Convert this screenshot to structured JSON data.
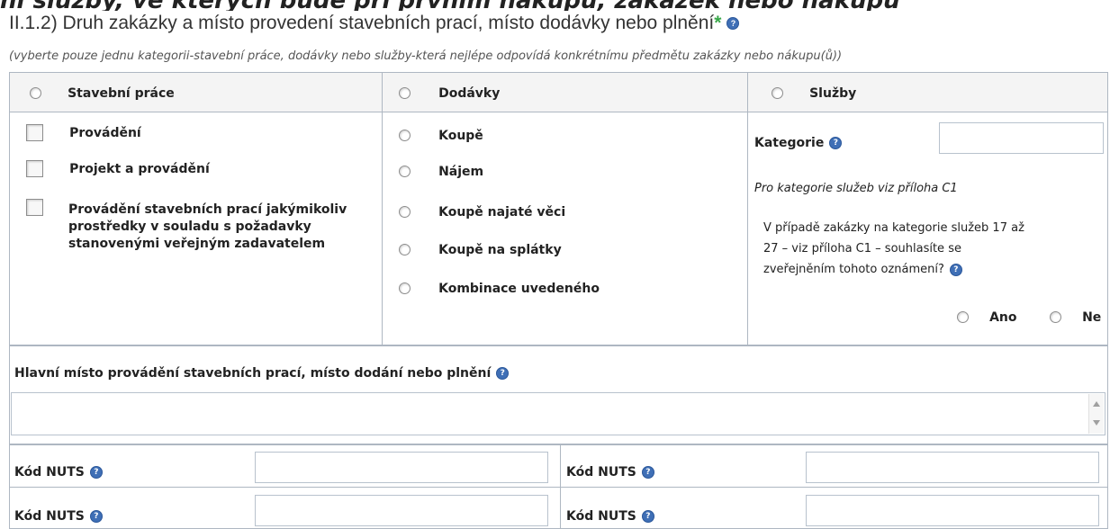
{
  "section": {
    "top_cut_text": "ní služby, ve kterých bude při prvním nákupu, zakázek nebo nákupu",
    "title": "II.1.2) Druh zakázky a místo provedení stavebních prací, místo dodávky nebo plnění",
    "required_mark": "*",
    "help_glyph": "?",
    "subtitle": "(vyberte pouze jednu kategorii-stavební práce, dodávky nebo služby-která nejlépe odpovídá konkrétnímu předmětu zakázky nebo nákupu(ů))"
  },
  "categories": {
    "construction": "Stavební práce",
    "supplies": "Dodávky",
    "services": "Služby"
  },
  "construction_options": [
    "Provádění",
    "Projekt a provádění",
    "Provádění stavebních prací jakýmikoliv",
    "prostředky v souladu s požadavky",
    "stanovenými veřejným zadavatelem"
  ],
  "supplies_options": [
    "Koupě",
    "Nájem",
    "Koupě najaté věci",
    "Koupě na splátky",
    "Kombinace uvedeného"
  ],
  "services": {
    "category_label": "Kategorie",
    "category_value": "",
    "annex_note": "Pro kategorie služeb viz příloha C1",
    "question_line1": "V případě zakázky na kategorie služeb 17 až",
    "question_line2": "27 – viz příloha C1 – souhlasíte se",
    "question_line3": "zveřejněním tohoto oznámení?",
    "yes": "Ano",
    "no": "Ne"
  },
  "place": {
    "label": "Hlavní místo provádění stavebních prací, místo dodání nebo plnění",
    "value": ""
  },
  "nuts": {
    "label": "Kód NUTS",
    "values": [
      "",
      "",
      "",
      ""
    ]
  },
  "colors": {
    "border": "#aeb7c2",
    "help_icon": "#3f6fb6",
    "required": "#39a84a",
    "header_bg": "#f4f4f4"
  }
}
